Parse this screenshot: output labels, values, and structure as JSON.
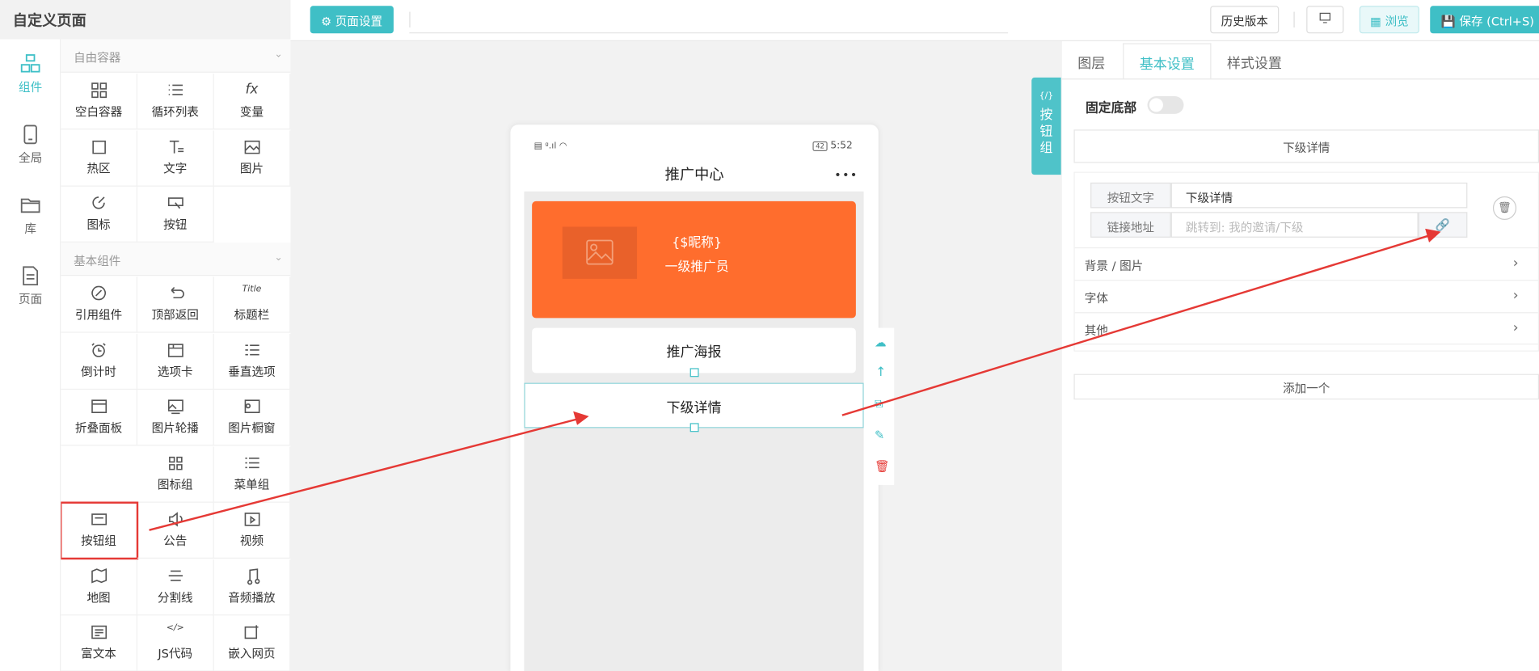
{
  "app": {
    "title": "自定义页面"
  },
  "rail": [
    {
      "label": "组件",
      "icon": "components-icon",
      "active": true
    },
    {
      "label": "全局",
      "icon": "tablet-icon"
    },
    {
      "label": "库",
      "icon": "folder-icon"
    },
    {
      "label": "页面",
      "icon": "page-icon"
    }
  ],
  "panel": {
    "section1": "自由容器",
    "section1_items": [
      "空白容器",
      "循环列表",
      "变量",
      "热区",
      "文字",
      "图片",
      "图标",
      "按钮"
    ],
    "section2": "基本组件",
    "section2_items": [
      "引用组件",
      "顶部返回",
      "标题栏",
      "倒计时",
      "选项卡",
      "垂直选项",
      "折叠面板",
      "图片轮播",
      "图片橱窗",
      "图标组",
      "菜单组",
      "按钮组",
      "公告",
      "视频",
      "地图",
      "分割线",
      "音频播放",
      "富文本",
      "JS代码",
      "嵌入网页"
    ],
    "icon_glyphs": {
      "变量": "fx",
      "标题栏": "Title",
      "JS代码": "</>"
    }
  },
  "toolbar": {
    "page_settings": "页面设置",
    "history": "历史版本",
    "preview": "浏览",
    "save": "保存 (Ctrl+S)"
  },
  "phone": {
    "status_time": "5:52",
    "battery": "42",
    "title": "推广中心",
    "more": "•••",
    "banner_name": "{$昵称}",
    "banner_role": "一级推广员",
    "btn1": "推广海报",
    "btn2": "下级详情"
  },
  "float_tag": {
    "code": "{/}",
    "label": "按钮组"
  },
  "right": {
    "tabs": [
      "图层",
      "基本设置",
      "样式设置"
    ],
    "fixed_bottom_label": "固定底部",
    "item_header": "下级详情",
    "btn_text_label": "按钮文字",
    "btn_text_value": "下级详情",
    "link_label": "链接地址",
    "link_placeholder": "跳转到: 我的邀请/下级",
    "rows": [
      "背景 / 图片",
      "字体",
      "其他"
    ],
    "add_one": "添加一个"
  },
  "colors": {
    "accent": "#3fbfc6",
    "banner": "#ff6d2d",
    "arrow": "#e53935"
  }
}
